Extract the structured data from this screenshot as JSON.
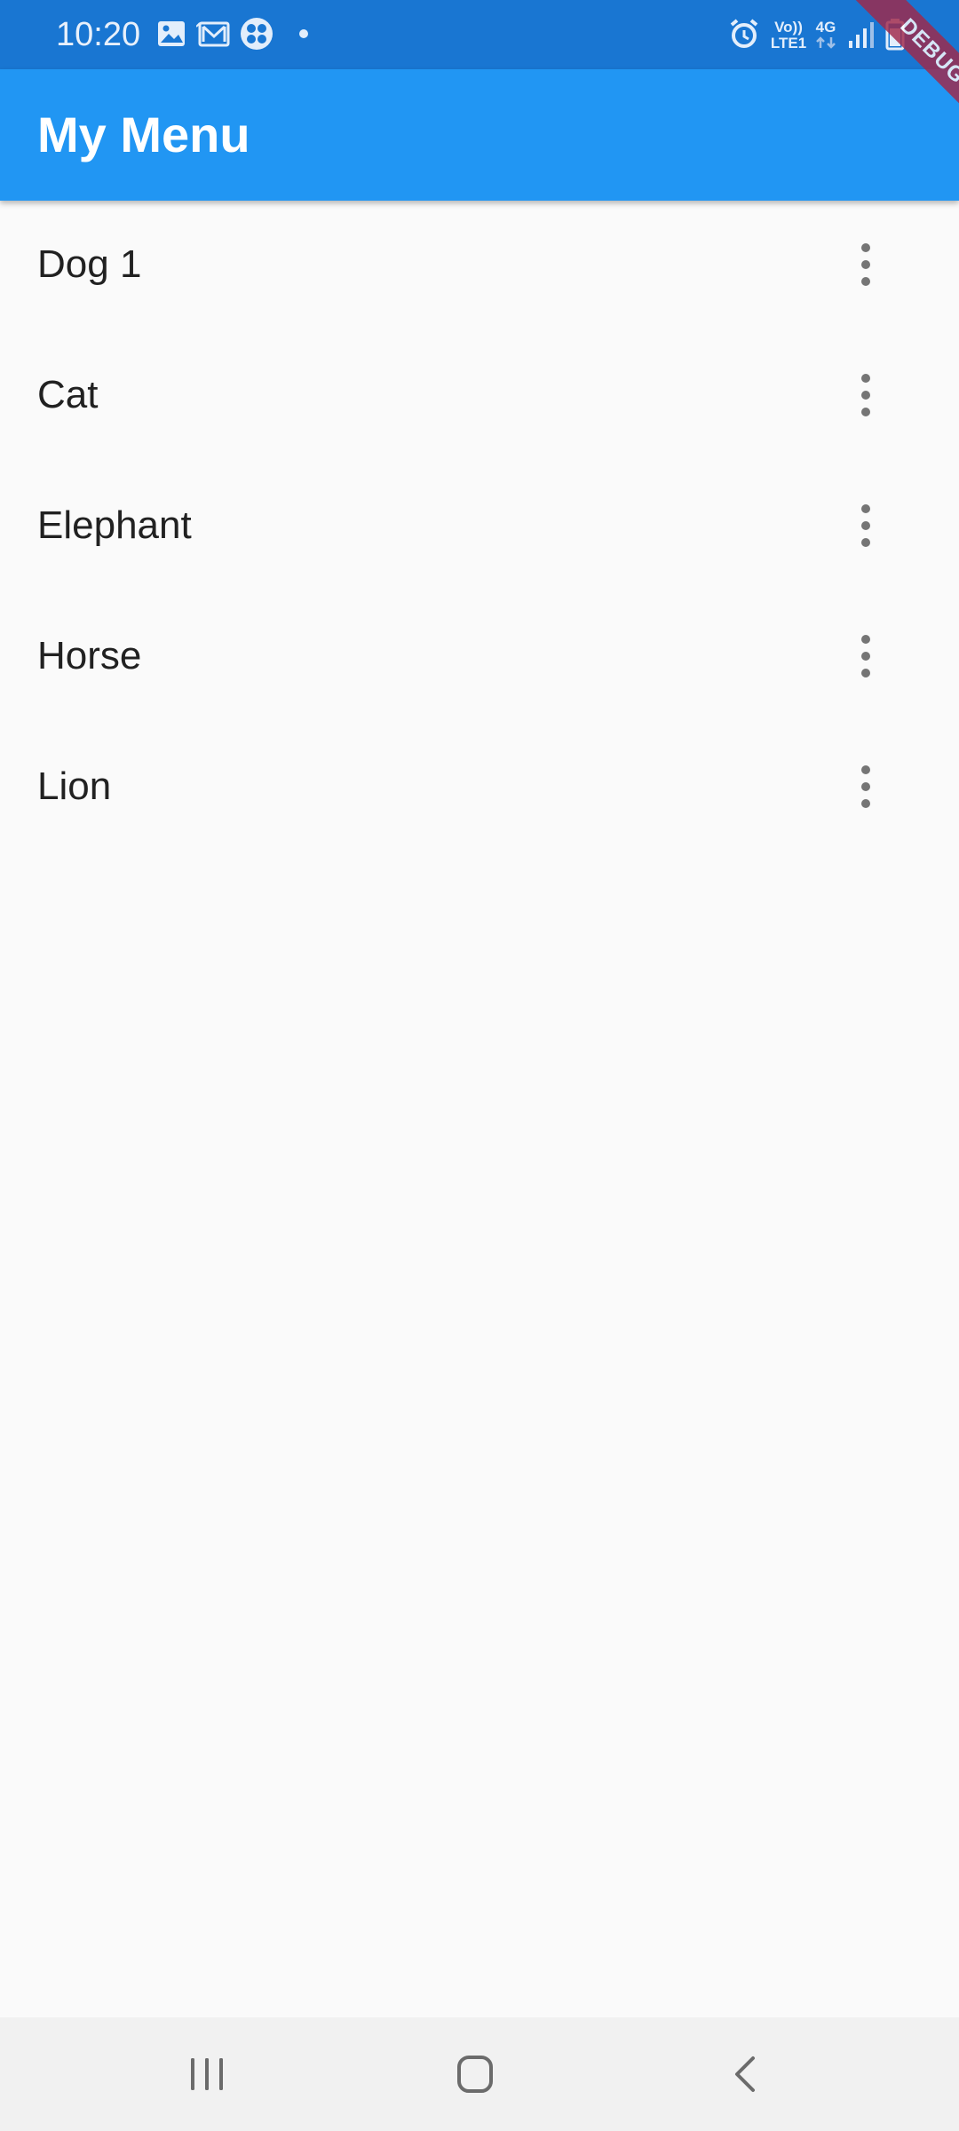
{
  "status_bar": {
    "time": "10:20",
    "volte_label": "Vo))",
    "lte_label": "LTE1",
    "network_label": "4G",
    "icons": [
      "image-icon",
      "gmail-icon",
      "app-icon",
      "dot-icon",
      "alarm-icon",
      "volte-icon",
      "4g-icon",
      "signal-icon",
      "battery-icon"
    ],
    "background_color": "#1976d2"
  },
  "app_bar": {
    "title": "My Menu",
    "background_color": "#2196f3"
  },
  "debug_banner": {
    "label": "DEBUG"
  },
  "list": {
    "items": [
      {
        "label": "Dog 1",
        "menu_icon": "more-vert-icon"
      },
      {
        "label": "Cat",
        "menu_icon": "more-vert-icon"
      },
      {
        "label": "Elephant",
        "menu_icon": "more-vert-icon"
      },
      {
        "label": "Horse",
        "menu_icon": "more-vert-icon"
      },
      {
        "label": "Lion",
        "menu_icon": "more-vert-icon"
      }
    ]
  },
  "nav_bar": {
    "buttons": [
      "recents-icon",
      "home-icon",
      "back-icon"
    ]
  }
}
